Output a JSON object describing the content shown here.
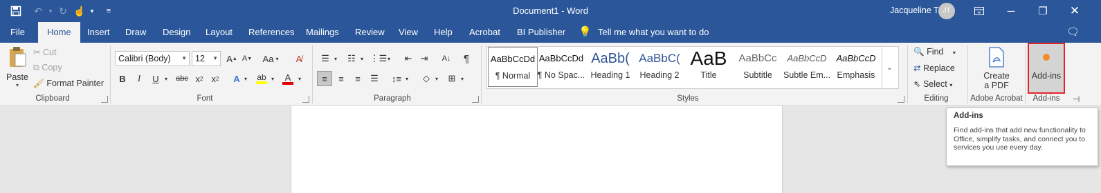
{
  "titlebar": {
    "title": "Document1  -  Word",
    "user_name": "Jacqueline T",
    "user_initials": "JT"
  },
  "tabs": [
    {
      "label": "File"
    },
    {
      "label": "Home"
    },
    {
      "label": "Insert"
    },
    {
      "label": "Draw"
    },
    {
      "label": "Design"
    },
    {
      "label": "Layout"
    },
    {
      "label": "References"
    },
    {
      "label": "Mailings"
    },
    {
      "label": "Review"
    },
    {
      "label": "View"
    },
    {
      "label": "Help"
    },
    {
      "label": "Acrobat"
    },
    {
      "label": "BI Publisher"
    }
  ],
  "tell_me": "Tell me what you want to do",
  "clipboard": {
    "paste": "Paste",
    "cut": "Cut",
    "copy": "Copy",
    "format_painter": "Format Painter",
    "group": "Clipboard"
  },
  "font": {
    "name": "Calibri (Body)",
    "size": "12",
    "case_label": "Aa",
    "group": "Font"
  },
  "paragraph": {
    "group": "Paragraph"
  },
  "styles": {
    "items": [
      {
        "preview": "AaBbCcDd",
        "name": "¶ Normal"
      },
      {
        "preview": "AaBbCcDd",
        "name": "¶ No Spac..."
      },
      {
        "preview": "AaBb(",
        "name": "Heading 1"
      },
      {
        "preview": "AaBbC(",
        "name": "Heading 2"
      },
      {
        "preview": "AaB",
        "name": "Title"
      },
      {
        "preview": "AaBbCc",
        "name": "Subtitle"
      },
      {
        "preview": "AaBbCcD",
        "name": "Subtle Em..."
      },
      {
        "preview": "AaBbCcD",
        "name": "Emphasis"
      }
    ],
    "group": "Styles"
  },
  "editing": {
    "find": "Find",
    "replace": "Replace",
    "select": "Select",
    "group": "Editing"
  },
  "adobe": {
    "create_line1": "Create",
    "create_line2": "a PDF",
    "group": "Adobe Acrobat"
  },
  "addins": {
    "button": "Add-ins",
    "group": "Add-ins"
  },
  "tooltip": {
    "title": "Add-ins",
    "body": "Find add-ins that add new functionality to Office, simplify tasks, and connect you to services you use every day."
  },
  "colors": {
    "brand": "#2b579a",
    "ribbon": "#f3f3f3",
    "highlight_yellow": "#ffff00",
    "font_color_red": "#e00000",
    "addins_outline": "#e0242b"
  }
}
